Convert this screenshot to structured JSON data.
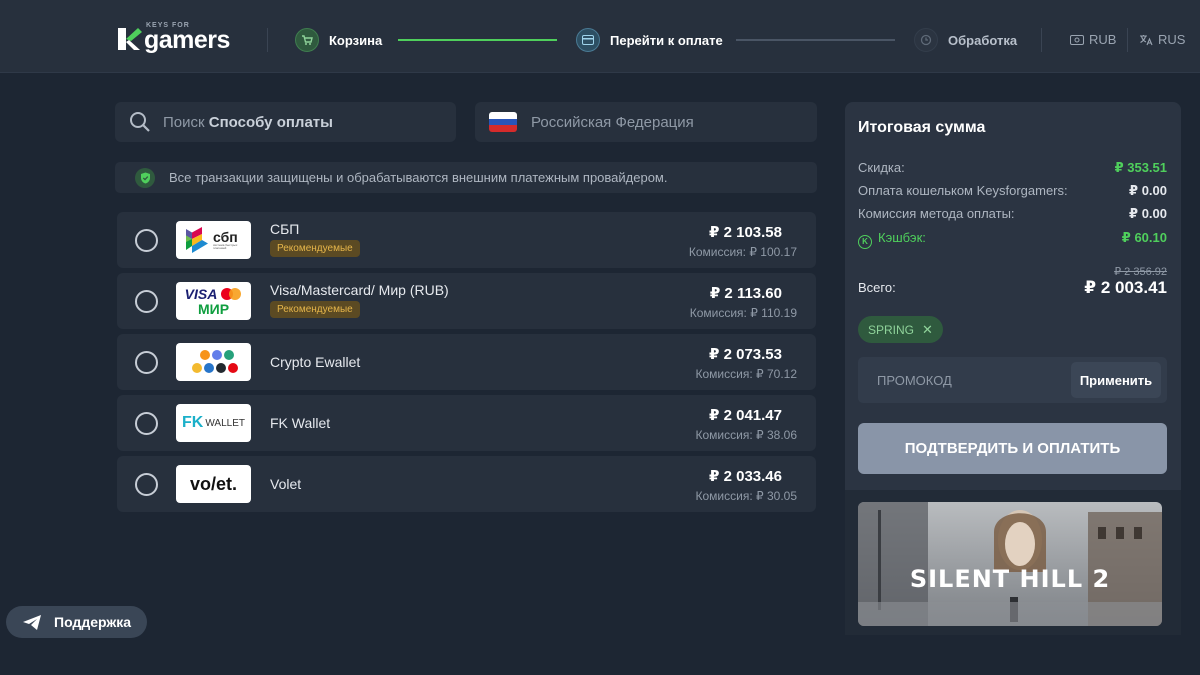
{
  "header": {
    "logo_small": "KEYS FOR",
    "logo_word": "gamers",
    "steps": [
      {
        "label": "Корзина"
      },
      {
        "label": "Перейти к оплате"
      },
      {
        "label": "Обработка"
      }
    ],
    "currency": "RUB",
    "language": "RUS"
  },
  "search": {
    "prefix": "Поиск",
    "bold": "Способу оплаты"
  },
  "country": {
    "label": "Российская Федерация"
  },
  "notice": "Все транзакции защищены и обрабатываются внешним платежным провайдером.",
  "methods": [
    {
      "name": "СБП",
      "badge": "Рекомендуемые",
      "price": "₽ 2 103.58",
      "fee": "Комиссия: ₽ 100.17",
      "logo": "sbp-logo"
    },
    {
      "name": "Visa/Mastercard/ Мир (RUB)",
      "badge": "Рекомендуемые",
      "price": "₽ 2 113.60",
      "fee": "Комиссия: ₽ 110.19",
      "logo": "cards-logo"
    },
    {
      "name": "Crypto Ewallet",
      "badge": "",
      "price": "₽ 2 073.53",
      "fee": "Комиссия: ₽ 70.12",
      "logo": "crypto-logo"
    },
    {
      "name": "FK Wallet",
      "badge": "",
      "price": "₽ 2 041.47",
      "fee": "Комиссия: ₽ 38.06",
      "logo": "fkwallet-logo"
    },
    {
      "name": "Volet",
      "badge": "",
      "price": "₽ 2 033.46",
      "fee": "Комиссия: ₽ 30.05",
      "logo": "volet-logo"
    }
  ],
  "logo_texts": {
    "sbp": "сбп",
    "sbp_sub": "система быстрых платежей",
    "visa": "VISA",
    "mir": "МИР",
    "fk": "FK",
    "wallet": "WALLET",
    "volet": "vo/et."
  },
  "support": "Поддержка",
  "summary": {
    "title": "Итоговая сумма",
    "rows": [
      {
        "label": "Скидка:",
        "value": "₽ 353.51"
      },
      {
        "label": "Оплата кошельком Keysforgamers:",
        "value": "₽ 0.00"
      },
      {
        "label": "Комиссия метода оплаты:",
        "value": "₽ 0.00"
      },
      {
        "label": "Кэшбэк:",
        "value": "₽ 60.10"
      }
    ],
    "cashback_icon": "K",
    "total_label": "Всего:",
    "old_total": "₽ 2 356.92",
    "total": "₽ 2 003.41",
    "coupon": "SPRING",
    "promo_placeholder": "ПРОМОКОД",
    "apply_label": "Применить",
    "confirm_label": "ПОДТВЕРДИТЬ И ОПЛАТИТЬ",
    "game_title": "SILENT HILL 2"
  },
  "colors": {
    "accent_green": "#4fcf5c",
    "badge_bg": "#5b4a23",
    "badge_text": "#e5b54a",
    "confirm": "#8995a8"
  }
}
